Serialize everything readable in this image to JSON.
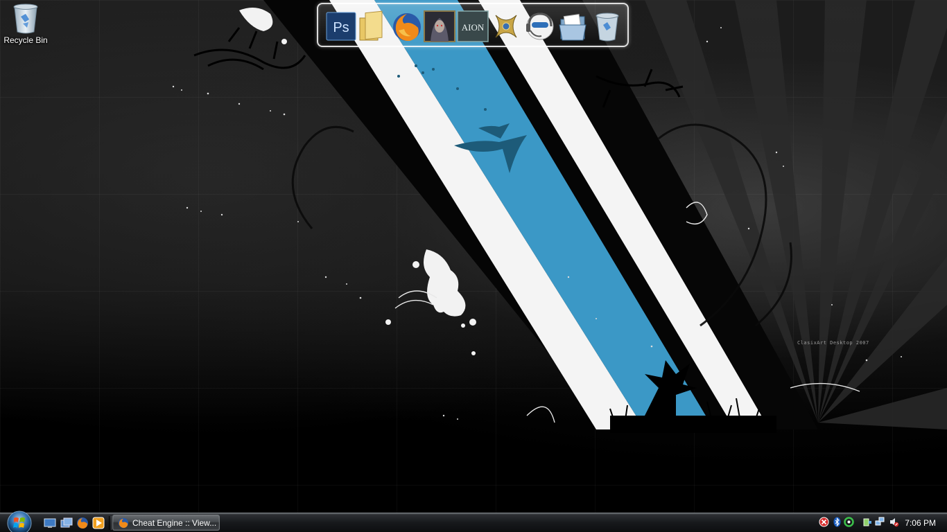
{
  "desktop": {
    "icons": [
      {
        "label": "Recycle Bin",
        "icon": "recycle-bin-icon"
      }
    ]
  },
  "wallpaper": {
    "credit": "ClasixArt Desktop 2007",
    "accent_color": "#3b98c6"
  },
  "dock": {
    "items": [
      {
        "name": "photoshop",
        "icon": "photoshop-icon",
        "text": "Ps"
      },
      {
        "name": "folder",
        "icon": "folder-icon"
      },
      {
        "name": "firefox",
        "icon": "firefox-icon"
      },
      {
        "name": "game-portrait",
        "icon": "game-portrait-icon"
      },
      {
        "name": "aion",
        "icon": "aion-icon",
        "text": "AION"
      },
      {
        "name": "golden-emblem",
        "icon": "emblem-icon"
      },
      {
        "name": "headset-helper",
        "icon": "headset-icon"
      },
      {
        "name": "documents-folder",
        "icon": "documents-folder-icon"
      },
      {
        "name": "recycle-bin",
        "icon": "recycle-bin-icon"
      }
    ]
  },
  "taskbar": {
    "start_button": "start-orb-icon",
    "quick_launch": [
      {
        "name": "show-desktop",
        "icon": "show-desktop-icon"
      },
      {
        "name": "switch-windows",
        "icon": "switch-windows-icon"
      },
      {
        "name": "firefox",
        "icon": "firefox-icon"
      },
      {
        "name": "media-player",
        "icon": "media-player-icon"
      }
    ],
    "tasks": [
      {
        "label": "Cheat Engine :: View...",
        "icon": "firefox-icon"
      }
    ],
    "tray": [
      {
        "name": "security-alert",
        "icon": "red-x-shield-icon"
      },
      {
        "name": "bluetooth",
        "icon": "bluetooth-icon"
      },
      {
        "name": "green-circle-app",
        "icon": "green-ring-icon"
      },
      {
        "name": "safely-remove",
        "icon": "usb-device-icon"
      },
      {
        "name": "network",
        "icon": "network-icon"
      },
      {
        "name": "volume-muted",
        "icon": "speaker-muted-icon"
      }
    ],
    "clock": "7:06 PM"
  }
}
